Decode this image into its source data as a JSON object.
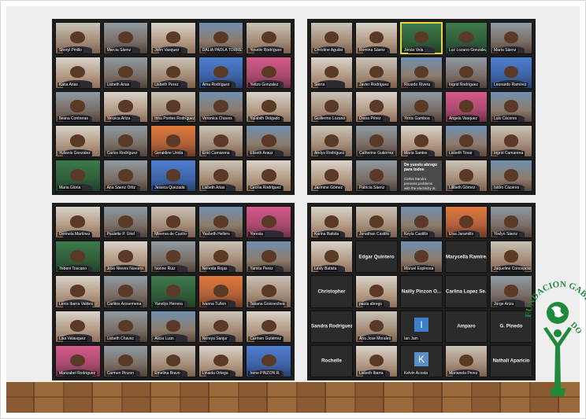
{
  "window_title": "",
  "panels": [
    {
      "id": "top-left",
      "tiles": [
        {
          "type": "video",
          "label": "Sheryl Pinillo",
          "tone": "c1"
        },
        {
          "type": "video",
          "label": "Marcia Sáenz",
          "tone": "c2"
        },
        {
          "type": "video",
          "label": "John Vasquez",
          "tone": "c3"
        },
        {
          "type": "video",
          "label": "DALIA PAOLA TORRES",
          "tone": "c4"
        },
        {
          "type": "video",
          "label": "Yoselin Rodríguez",
          "tone": "c1"
        },
        {
          "type": "video",
          "label": "Katia Arias",
          "tone": "c3"
        },
        {
          "type": "video",
          "label": "Lisbeth Arias",
          "tone": "c2"
        },
        {
          "type": "video",
          "label": "Lisbeth Perez",
          "tone": "c1"
        },
        {
          "type": "video",
          "label": "Ama Rodríguez",
          "tone": "c8"
        },
        {
          "type": "video",
          "label": "Yeitzo Gonzalez",
          "tone": "c6"
        },
        {
          "type": "video",
          "label": "Ileana Contreras",
          "tone": "c2"
        },
        {
          "type": "video",
          "label": "Yessica Ariza",
          "tone": "c3"
        },
        {
          "type": "video",
          "label": "Irina Pontes Rodríguez",
          "tone": "c1"
        },
        {
          "type": "video",
          "label": "Veronica Chaves",
          "tone": "c4"
        },
        {
          "type": "video",
          "label": "Yulabith Delgado",
          "tone": "c3"
        },
        {
          "type": "video",
          "label": "Yulianis Gonzalez",
          "tone": "c3"
        },
        {
          "type": "video",
          "label": "Carlos Rodríguez",
          "tone": "c2"
        },
        {
          "type": "video",
          "label": "Geraldine Uriola",
          "tone": "c7"
        },
        {
          "type": "video",
          "label": "Enid Camarena",
          "tone": "c1"
        },
        {
          "type": "video",
          "label": "Eliseth Arauz",
          "tone": "c4"
        },
        {
          "type": "video",
          "label": "Maria Gloria",
          "tone": "c5"
        },
        {
          "type": "video",
          "label": "Ana Sáenz Ortiz",
          "tone": "c2"
        },
        {
          "type": "video",
          "label": "Jessica Quezada",
          "tone": "c8"
        },
        {
          "type": "video",
          "label": "Lisbeth Arias",
          "tone": "c1"
        },
        {
          "type": "video",
          "label": "Cecilia Rodríguez",
          "tone": "c3"
        }
      ]
    },
    {
      "id": "top-right",
      "tiles": [
        {
          "type": "video",
          "label": "Christine Aguilar",
          "tone": "c1"
        },
        {
          "type": "video",
          "label": "Romina Sáenz",
          "tone": "c3"
        },
        {
          "type": "video",
          "label": "Jonás Vela",
          "tone": "c5",
          "active": true
        },
        {
          "type": "video",
          "label": "Luz Lozano Gonzalez",
          "tone": "c5"
        },
        {
          "type": "video",
          "label": "María Sáenz",
          "tone": "c2"
        },
        {
          "type": "video",
          "label": "Sierra",
          "tone": "c3"
        },
        {
          "type": "video",
          "label": "Javier Rodríguez",
          "tone": "c1"
        },
        {
          "type": "video",
          "label": "Ricardo Rivera",
          "tone": "c4"
        },
        {
          "type": "video",
          "label": "Ingrid Rodríguez",
          "tone": "c2"
        },
        {
          "type": "video",
          "label": "Leonardo Ramírez",
          "tone": "c8"
        },
        {
          "type": "video",
          "label": "Guillermo Lozano",
          "tone": "c1"
        },
        {
          "type": "video",
          "label": "Diana Pérez",
          "tone": "c3"
        },
        {
          "type": "video",
          "label": "Yenis Gamboa",
          "tone": "c2"
        },
        {
          "type": "video",
          "label": "Angela Vasquez",
          "tone": "c6"
        },
        {
          "type": "video",
          "label": "Luis Cáceres",
          "tone": "c4"
        },
        {
          "type": "video",
          "label": "Arelys Rodríguez",
          "tone": "c1"
        },
        {
          "type": "video",
          "label": "Catherine Gutiérrez",
          "tone": "c2"
        },
        {
          "type": "video",
          "label": "Maria Santos",
          "tone": "c3"
        },
        {
          "type": "video",
          "label": "Lisbeth Tovar",
          "tone": "c4"
        },
        {
          "type": "video",
          "label": "Ingrid Camarena",
          "tone": "c1"
        },
        {
          "type": "video",
          "label": "Jazmine Gómez",
          "tone": "c3"
        },
        {
          "type": "video",
          "label": "Patricia Sáenz",
          "tone": "c2"
        },
        {
          "type": "notification",
          "title": "De yuestu abrego para todos",
          "body": "Carlos Sandro presents problems with the electricity at her house"
        },
        {
          "type": "video",
          "label": "Lilibeth Gómez",
          "tone": "c1"
        },
        {
          "type": "video",
          "label": "Isidro Cáceres",
          "tone": "c4"
        }
      ]
    },
    {
      "id": "bottom-left",
      "tiles": [
        {
          "type": "video",
          "label": "Dorinela Martínez",
          "tone": "c3"
        },
        {
          "type": "video",
          "label": "Paulette P. Uriel",
          "tone": "c2"
        },
        {
          "type": "video",
          "label": "Minerva de Castro",
          "tone": "c1"
        },
        {
          "type": "video",
          "label": "Yasbeth Hellers",
          "tone": "c4"
        },
        {
          "type": "video",
          "label": "Yoresia",
          "tone": "c6"
        },
        {
          "type": "video",
          "label": "Yebeni Toscano",
          "tone": "c5"
        },
        {
          "type": "video",
          "label": "Jose Nieves Navarro",
          "tone": "c3"
        },
        {
          "type": "video",
          "label": "Ivonne Ruiz",
          "tone": "c2"
        },
        {
          "type": "video",
          "label": "Nereida Rojas",
          "tone": "c1"
        },
        {
          "type": "video",
          "label": "Yamila Perez",
          "tone": "c4"
        },
        {
          "type": "video",
          "label": "Lenis Ibarra Valdes",
          "tone": "c3"
        },
        {
          "type": "video",
          "label": "Carlitos Arosemena",
          "tone": "c2"
        },
        {
          "type": "video",
          "label": "Yanelys Herrera",
          "tone": "c5"
        },
        {
          "type": "video",
          "label": "Ivanna Tuñon",
          "tone": "c7"
        },
        {
          "type": "video",
          "label": "Tatiana Goicoechea",
          "tone": "c1"
        },
        {
          "type": "video",
          "label": "Lisa Velasquez",
          "tone": "c3"
        },
        {
          "type": "video",
          "label": "Lisbeth Chavez",
          "tone": "c2"
        },
        {
          "type": "video",
          "label": "Alicia Luan",
          "tone": "c4"
        },
        {
          "type": "video",
          "label": "Nereya Sanjur",
          "tone": "c1"
        },
        {
          "type": "video",
          "label": "Carmen Gutiérrez",
          "tone": "c3"
        },
        {
          "type": "video",
          "label": "Marizabel Rodríguez",
          "tone": "c6"
        },
        {
          "type": "video",
          "label": "Carmen Pinzon",
          "tone": "c2"
        },
        {
          "type": "video",
          "label": "Emelina Bravo",
          "tone": "c1"
        },
        {
          "type": "video",
          "label": "Linaida Ortega",
          "tone": "c3"
        },
        {
          "type": "video",
          "label": "Irene PINZON R.",
          "tone": "c8"
        }
      ]
    },
    {
      "id": "bottom-right",
      "tiles": [
        {
          "type": "video",
          "label": "Karina Batista",
          "tone": "c3"
        },
        {
          "type": "video",
          "label": "Jonathan Castillo",
          "tone": "c1"
        },
        {
          "type": "video",
          "label": "Keyla Castillo",
          "tone": "c4"
        },
        {
          "type": "video",
          "label": "Elsa Jaramillo",
          "tone": "c7"
        },
        {
          "type": "video",
          "label": "Yoslyn Sáenz",
          "tone": "c2"
        },
        {
          "type": "video",
          "label": "Lesly Batista",
          "tone": "c3"
        },
        {
          "type": "text",
          "label": "Edgar Quintero"
        },
        {
          "type": "video",
          "label": "Maruel Espinosa",
          "tone": "c4"
        },
        {
          "type": "text",
          "label": "Marycella Ramire..."
        },
        {
          "type": "video",
          "label": "Jaqueline Concepcion",
          "tone": "c1"
        },
        {
          "type": "text",
          "label": "Christopher"
        },
        {
          "type": "video",
          "label": "paola abrego",
          "tone": "c3"
        },
        {
          "type": "text",
          "label": "Nailly Pinzon O..."
        },
        {
          "type": "text",
          "label": "Carlina Lopez Se..."
        },
        {
          "type": "video",
          "label": "Jorge Ariza",
          "tone": "c2"
        },
        {
          "type": "text",
          "label": "Sandra Rodriguez"
        },
        {
          "type": "video",
          "label": "Ana Jose Morales",
          "tone": "c1"
        },
        {
          "type": "letter",
          "label": "Ian Jam",
          "letter": "I"
        },
        {
          "type": "text",
          "label": "Amparo"
        },
        {
          "type": "text",
          "label": "G. Pinedo"
        },
        {
          "type": "text",
          "label": "Rochelle"
        },
        {
          "type": "video",
          "label": "Lisbeth Ibarra",
          "tone": "c3"
        },
        {
          "type": "letter",
          "label": "Kelvin Acosta",
          "letter": "K"
        },
        {
          "type": "video",
          "label": "Marianela Perez",
          "tone": "c1"
        },
        {
          "type": "text",
          "label": "Nathali Aparicio"
        }
      ]
    }
  ],
  "logo": {
    "text_upper": "FUNDACION GABRIEL LE",
    "text_lower": "DO",
    "color": "#1f8a3c"
  }
}
